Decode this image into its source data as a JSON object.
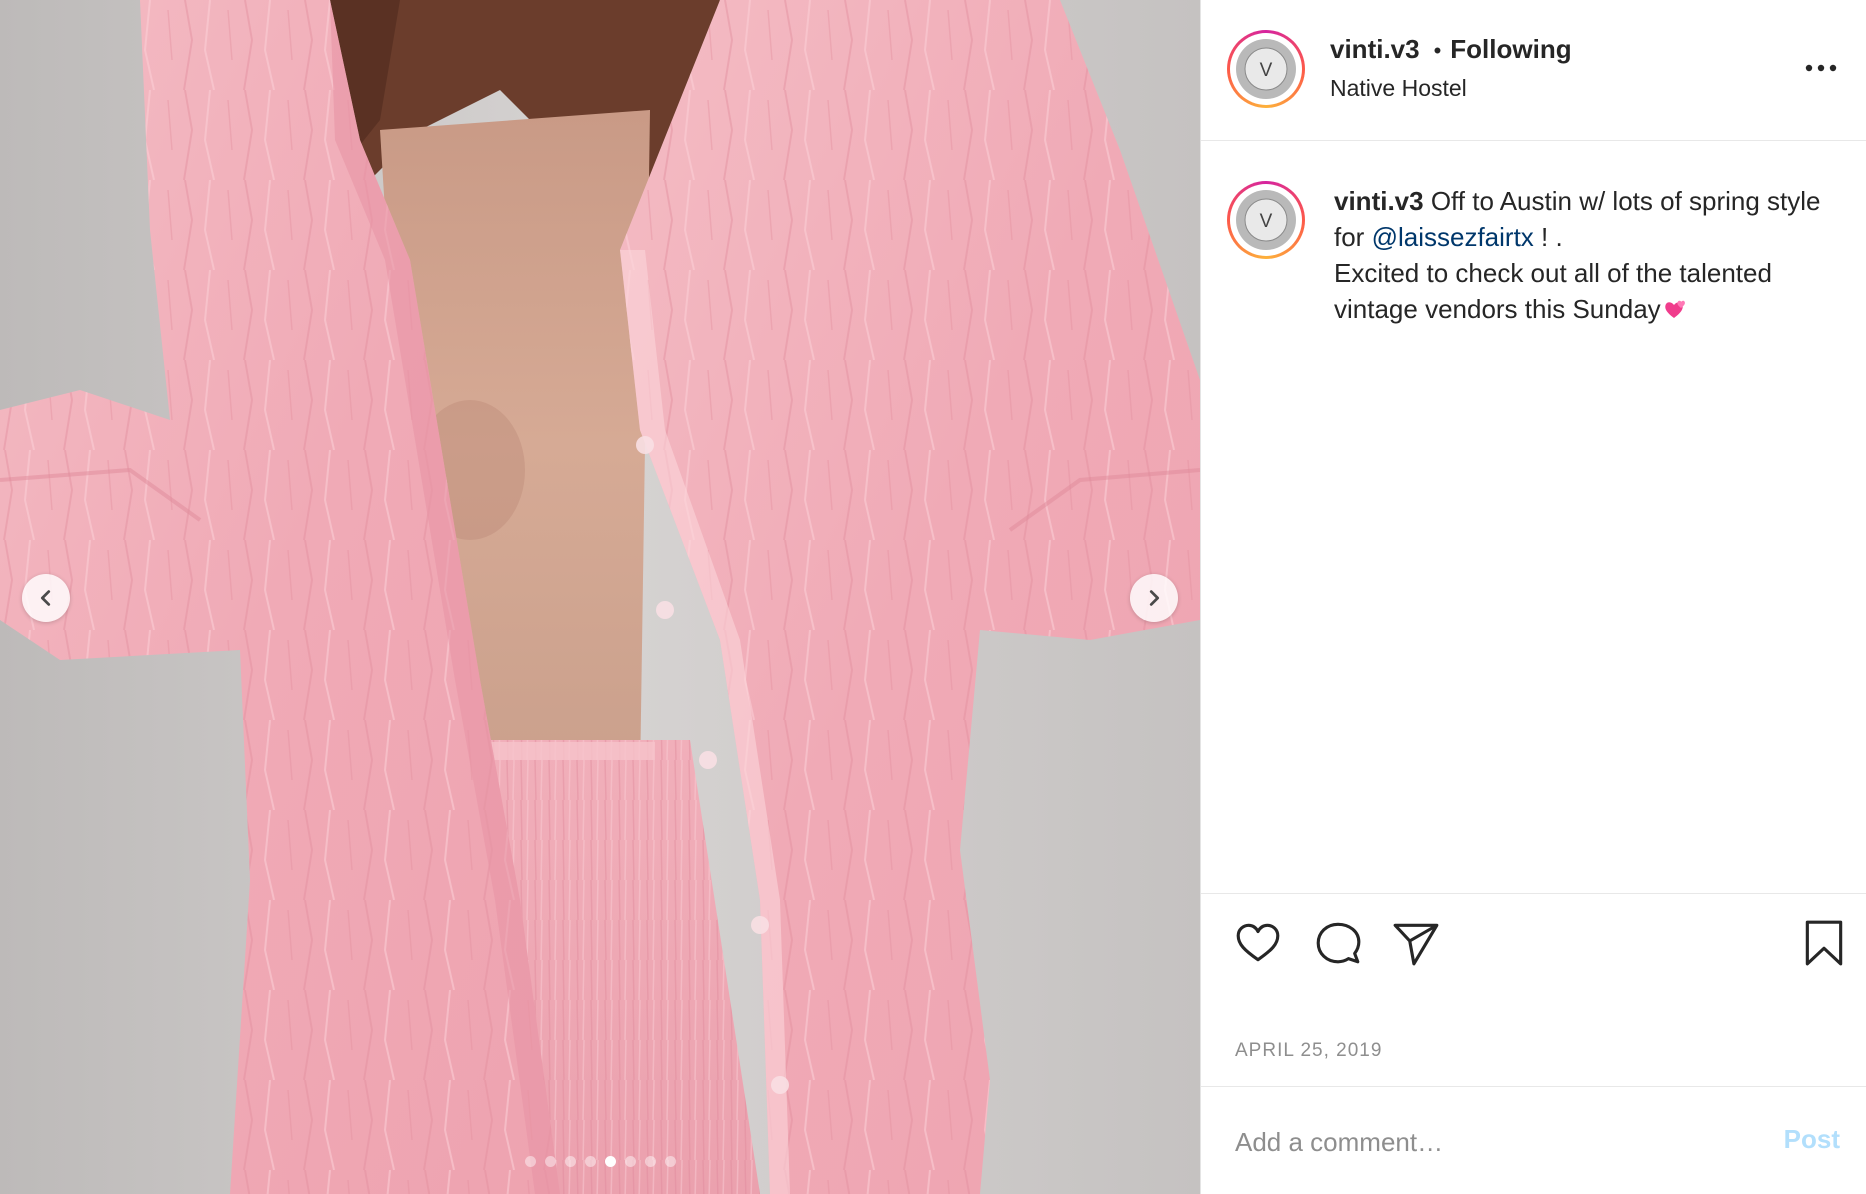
{
  "post": {
    "username": "vinti.v3",
    "separator": "•",
    "follow_status": "Following",
    "location": "Native Hostel",
    "avatar_letter": "V"
  },
  "caption": {
    "username": "vinti.v3",
    "text_part1": " Off to Austin w/ lots of spring style for ",
    "mention": "@laissezfairtx",
    "text_part2": " ! .",
    "line2": "Excited to check out all of the talented vintage vendors this Sunday",
    "emoji": "two-hearts-emoji"
  },
  "media": {
    "slide_count": 8,
    "active_slide": 5,
    "prev_icon": "chevron-left-icon",
    "next_icon": "chevron-right-icon"
  },
  "actions": {
    "like_icon": "heart-icon",
    "comment_icon": "comment-bubble-icon",
    "share_icon": "paper-plane-icon",
    "save_icon": "bookmark-icon"
  },
  "date": "APRIL 25, 2019",
  "comment": {
    "placeholder": "Add a comment…",
    "post_label": "Post"
  },
  "colors": {
    "text": "#262626",
    "muted": "#8e8e8e",
    "mention": "#00376b",
    "post_disabled": "#b2dffc",
    "garment_pink": "#f2b3bd"
  }
}
